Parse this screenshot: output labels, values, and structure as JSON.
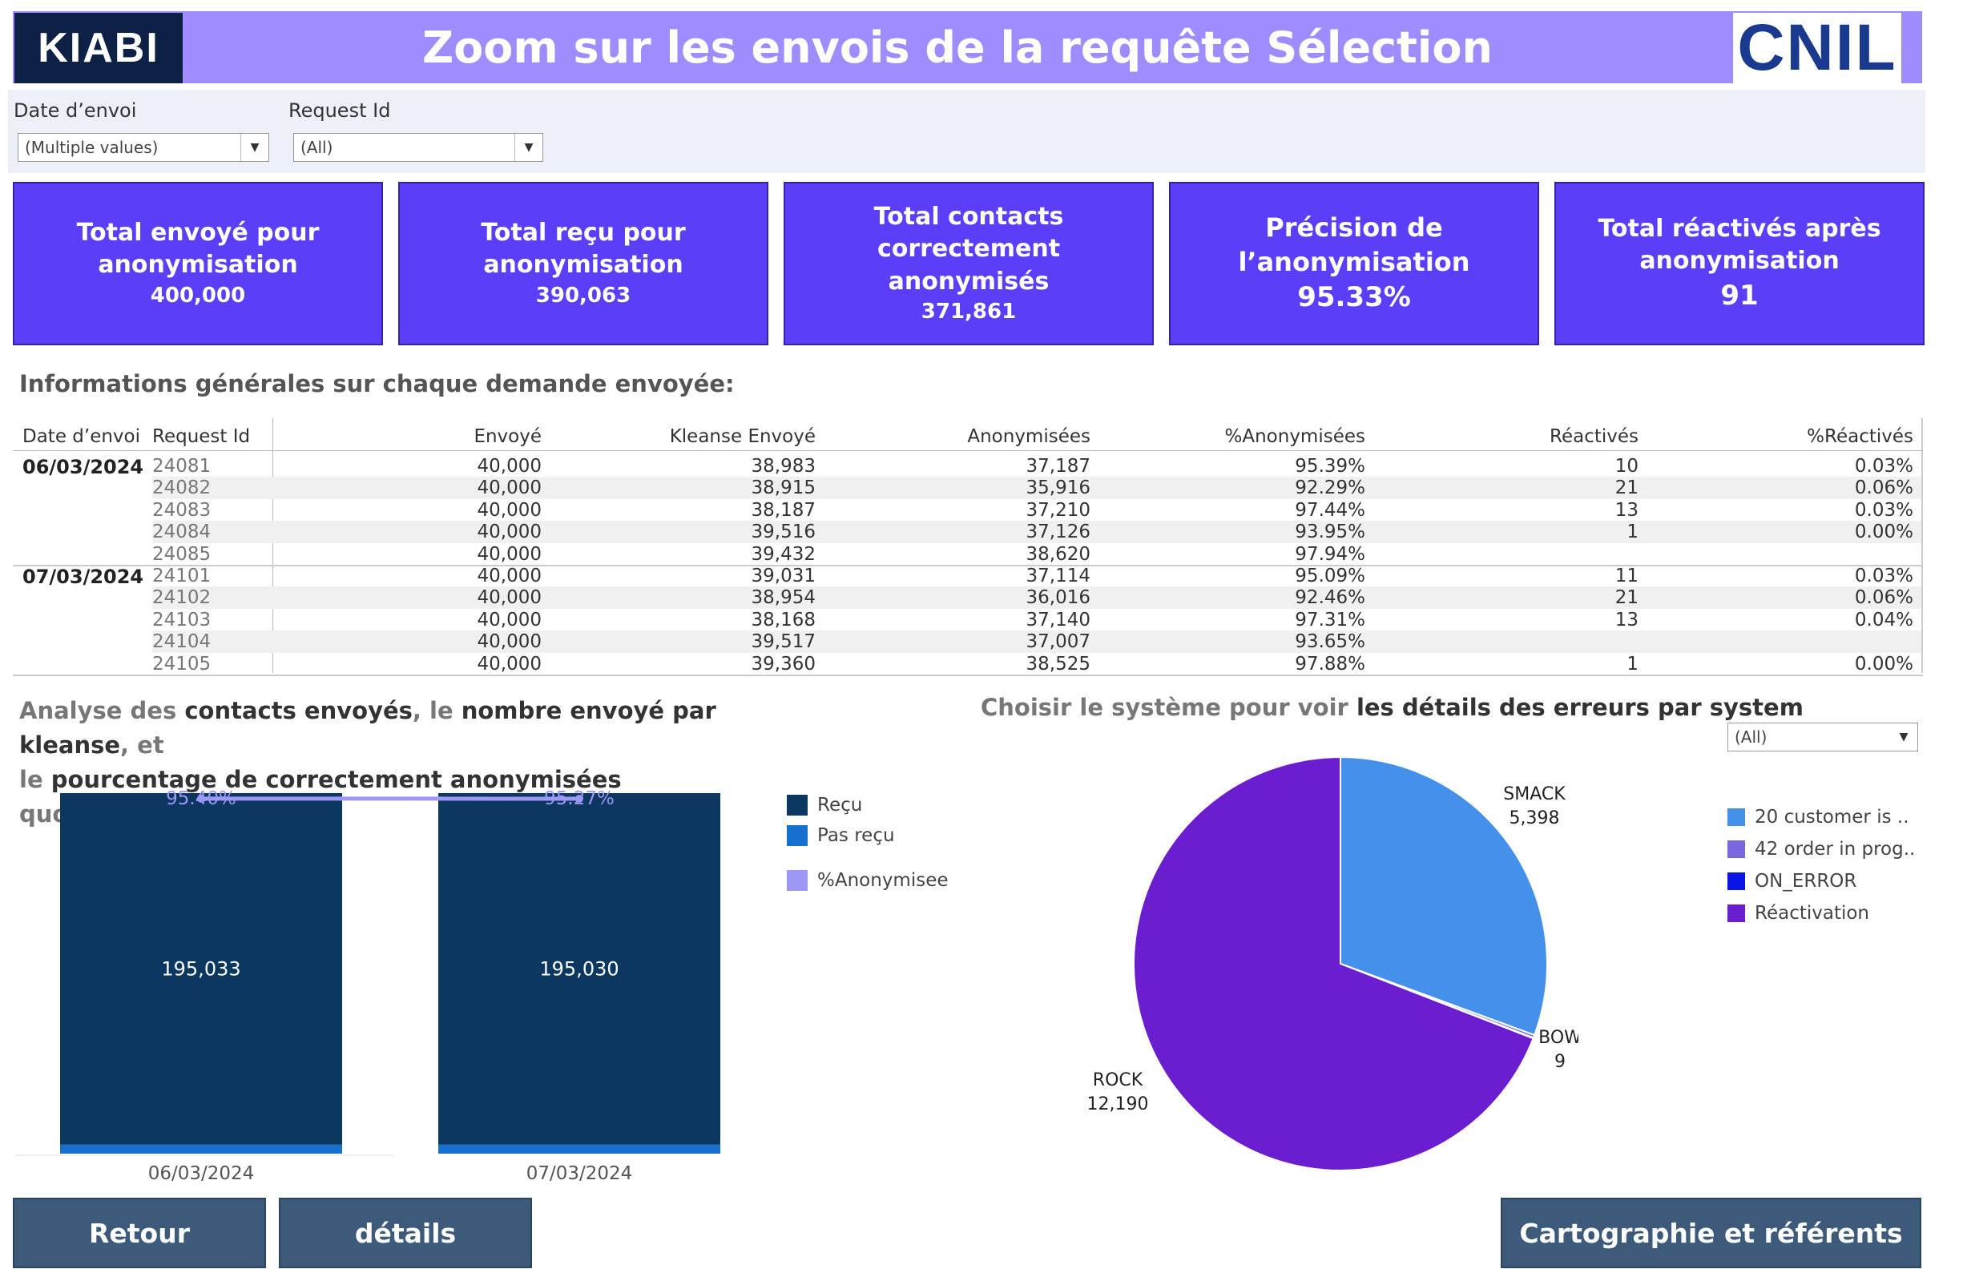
{
  "header": {
    "logo_left": "KIABI",
    "title": "Zoom sur les envois de la requête Sélection",
    "logo_right": "CNIL"
  },
  "filters": {
    "date": {
      "label": "Date d’envoi",
      "value": "(Multiple values)"
    },
    "request": {
      "label": "Request Id",
      "value": "(All)"
    }
  },
  "kpis": [
    {
      "title": "Total envoyé pour anonymisation",
      "value": "400,000"
    },
    {
      "title": "Total reçu pour anonymisation",
      "value": "390,063"
    },
    {
      "title": "Total contacts correctement anonymisés",
      "value": "371,861"
    },
    {
      "title": "Précision de l’anonymisation",
      "value": "95.33%"
    },
    {
      "title": "Total réactivés après anonymisation",
      "value": "91"
    }
  ],
  "table": {
    "title": "Informations générales sur chaque demande envoyée:",
    "headers": [
      "Date d’envoi",
      "Request Id",
      "Envoyé",
      "Kleanse Envoyé",
      "Anonymisées",
      "%Anonymisées",
      "Réactivés",
      "%Réactivés"
    ],
    "groups": [
      {
        "date": "06/03/2024",
        "rows": [
          [
            "24081",
            "40,000",
            "38,983",
            "37,187",
            "95.39%",
            "10",
            "0.03%"
          ],
          [
            "24082",
            "40,000",
            "38,915",
            "35,916",
            "92.29%",
            "21",
            "0.06%"
          ],
          [
            "24083",
            "40,000",
            "38,187",
            "37,210",
            "97.44%",
            "13",
            "0.03%"
          ],
          [
            "24084",
            "40,000",
            "39,516",
            "37,126",
            "93.95%",
            "1",
            "0.00%"
          ],
          [
            "24085",
            "40,000",
            "39,432",
            "38,620",
            "97.94%",
            "",
            ""
          ]
        ]
      },
      {
        "date": "07/03/2024",
        "rows": [
          [
            "24101",
            "40,000",
            "39,031",
            "37,114",
            "95.09%",
            "11",
            "0.03%"
          ],
          [
            "24102",
            "40,000",
            "38,954",
            "36,016",
            "92.46%",
            "21",
            "0.06%"
          ],
          [
            "24103",
            "40,000",
            "38,168",
            "37,140",
            "97.31%",
            "13",
            "0.04%"
          ],
          [
            "24104",
            "40,000",
            "39,517",
            "37,007",
            "93.65%",
            "",
            ""
          ],
          [
            "24105",
            "40,000",
            "39,360",
            "38,525",
            "97.88%",
            "1",
            "0.00%"
          ]
        ]
      }
    ]
  },
  "bar_section": {
    "title_parts": [
      {
        "text": "Analyse des ",
        "style": "grey"
      },
      {
        "text": "contacts envoyés",
        "style": "dark"
      },
      {
        "text": ", le ",
        "style": "grey"
      },
      {
        "text": "nombre envoyé par kleanse",
        "style": "dark"
      },
      {
        "text": ", et",
        "style": "grey"
      },
      {
        "text": "le ",
        "style": "grey"
      },
      {
        "text": "pourcentage de correctement anonymisées",
        "style": "dark"
      },
      {
        "text": " quotidiennement",
        "style": "grey"
      }
    ],
    "legend": [
      {
        "label": "Reçu",
        "color": "#0b3760"
      },
      {
        "label": "Pas reçu",
        "color": "#1570d0"
      },
      {
        "label": "%Anonymisee",
        "color": "#9d97f5"
      }
    ]
  },
  "pie_section": {
    "title_grey": "Choisir le système pour voir ",
    "title_dark": "les détails des erreurs par system",
    "filter_value": "(All)",
    "legend": [
      {
        "label": "20 customer is ..",
        "color": "#4590ea"
      },
      {
        "label": "42 order in prog..",
        "color": "#7a66dd"
      },
      {
        "label": "ON_ERROR",
        "color": "#0a14e6"
      },
      {
        "label": "Réactivation",
        "color": "#6a1ecf"
      }
    ]
  },
  "chart_data": [
    {
      "type": "bar",
      "categories": [
        "06/03/2024",
        "07/03/2024"
      ],
      "series": [
        {
          "name": "Reçu",
          "values": [
            195033,
            195030
          ],
          "color": "#0b3760"
        },
        {
          "name": "Pas reçu",
          "values": [
            4967,
            4970
          ],
          "color": "#1570d0"
        },
        {
          "name": "%Anonymisee",
          "values": [
            95.4,
            95.27
          ],
          "color": "#9d97f5",
          "kind": "line",
          "labels": [
            "95.40%",
            "95.27%"
          ]
        }
      ],
      "data_labels": [
        "195,033",
        "195,030"
      ],
      "ylim": [
        0,
        200000
      ]
    },
    {
      "type": "pie",
      "slices": [
        {
          "label": "SMACK",
          "value": 5398,
          "display": "5,398",
          "color": "#4590ea"
        },
        {
          "label": "",
          "value": 40,
          "display": "",
          "color": "#7a66dd"
        },
        {
          "label": "BOW",
          "value": 9,
          "display": "9",
          "color": "#0a14e6"
        },
        {
          "label": "ROCK",
          "value": 12190,
          "display": "12,190",
          "color": "#6a1ecf"
        }
      ]
    }
  ],
  "buttons": {
    "back": "Retour",
    "details": "détails",
    "carto": "Cartographie et référents"
  }
}
